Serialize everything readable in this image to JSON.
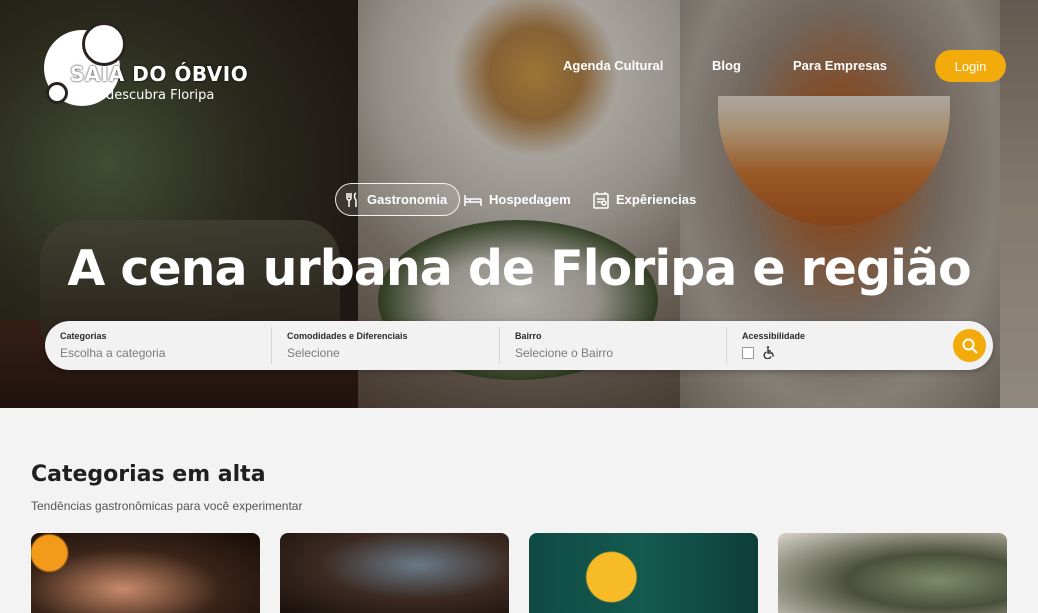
{
  "brand": {
    "line1_a": "SAIA",
    "line1_b": "DO ÓBVIO",
    "line2": "descubra Floripa"
  },
  "nav": {
    "items": [
      "Agenda Cultural",
      "Blog",
      "Para Empresas"
    ],
    "login": "Login"
  },
  "tabs": [
    {
      "label": "Gastronomia",
      "icon": "fork-knife-icon",
      "active": true
    },
    {
      "label": "Hospedagem",
      "icon": "bed-icon",
      "active": false
    },
    {
      "label": "Expêriencias",
      "icon": "ticket-icon",
      "active": false
    }
  ],
  "hero": {
    "headline": "A cena urbana de Floripa e região"
  },
  "search": {
    "fields": [
      {
        "label": "Categorias",
        "placeholder": "Escolha a categoria"
      },
      {
        "label": "Comodidades e Diferenciais",
        "placeholder": "Selecione"
      },
      {
        "label": "Bairro",
        "placeholder": "Selecione o Bairro"
      },
      {
        "label": "Acessibilidade"
      }
    ],
    "accessibility_icon": "wheelchair-icon",
    "button_icon": "search-icon"
  },
  "section": {
    "title": "Categorias em alta",
    "subtitle": "Tendências gastronômicas para você experimentar"
  },
  "colors": {
    "accent": "#f2ab0b"
  }
}
